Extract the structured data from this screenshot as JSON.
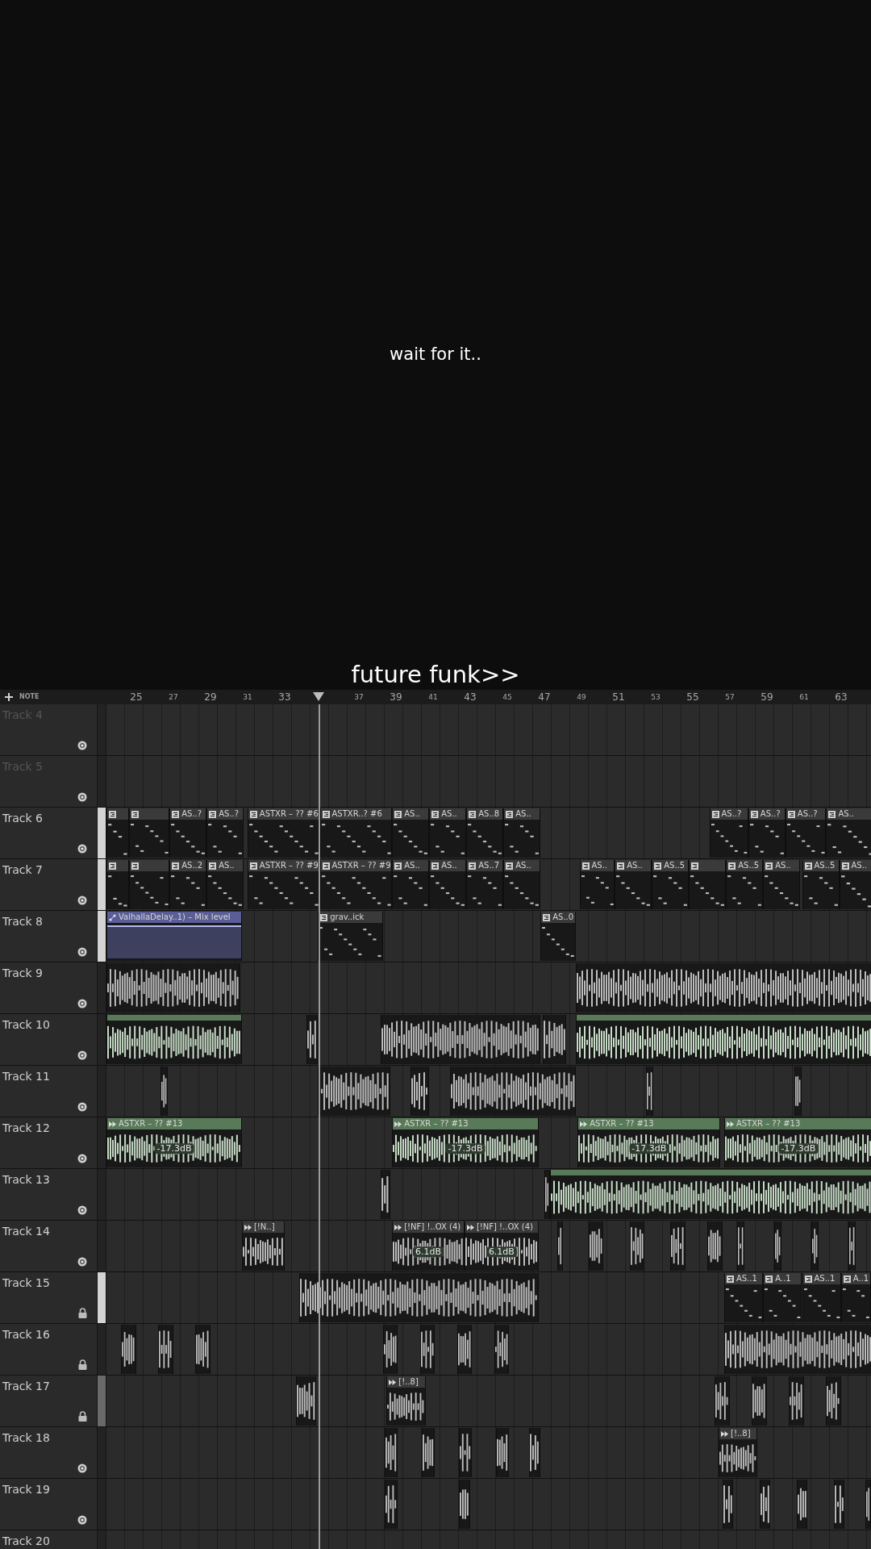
{
  "caption_top": "wait for it..",
  "caption_bottom": "future funk>>",
  "toolbar": {
    "mode": "NOTE"
  },
  "ruler": [
    "25",
    "27",
    "29",
    "31",
    "33",
    "37",
    "39",
    "41",
    "43",
    "45",
    "47",
    "49",
    "51",
    "53",
    "55",
    "57",
    "59",
    "61",
    "63"
  ],
  "tracks": [
    {
      "name": "Track 4",
      "muted": true,
      "locked": false
    },
    {
      "name": "Track 5",
      "muted": true,
      "locked": false
    },
    {
      "name": "Track 6",
      "muted": false,
      "locked": false,
      "color": "#d4d4d4",
      "clips": [
        {
          "kind": "pattern"
        },
        {
          "kind": "pattern"
        },
        {
          "kind": "pattern",
          "label": "AS..?"
        },
        {
          "kind": "pattern",
          "label": "AS..?"
        },
        {
          "kind": "pattern",
          "label": "ASTXR – ?? #6"
        },
        {
          "kind": "pattern",
          "label": "ASTXR..? #6"
        },
        {
          "kind": "pattern",
          "label": "AS.."
        },
        {
          "kind": "pattern",
          "label": "AS.."
        },
        {
          "kind": "pattern",
          "label": "AS..8"
        },
        {
          "kind": "pattern",
          "label": "AS.."
        },
        {
          "kind": "pattern",
          "label": "AS..?"
        },
        {
          "kind": "pattern",
          "label": "AS..?"
        },
        {
          "kind": "pattern",
          "label": "AS..?"
        },
        {
          "kind": "pattern",
          "label": "AS.."
        }
      ]
    },
    {
      "name": "Track 7",
      "muted": false,
      "locked": false,
      "color": "#d4d4d4",
      "clips": [
        {
          "kind": "pattern"
        },
        {
          "kind": "pattern"
        },
        {
          "kind": "pattern",
          "label": "AS..2"
        },
        {
          "kind": "pattern",
          "label": "AS.."
        },
        {
          "kind": "pattern",
          "label": "ASTXR – ?? #9"
        },
        {
          "kind": "pattern",
          "label": "ASTXR – ?? #9"
        },
        {
          "kind": "pattern",
          "label": "AS.."
        },
        {
          "kind": "pattern",
          "label": "AS.."
        },
        {
          "kind": "pattern",
          "label": "AS..7"
        },
        {
          "kind": "pattern",
          "label": "AS.."
        },
        {
          "kind": "pattern",
          "label": "AS.."
        },
        {
          "kind": "pattern",
          "label": "AS.."
        },
        {
          "kind": "pattern",
          "label": "AS..5"
        },
        {
          "kind": "pattern"
        },
        {
          "kind": "pattern",
          "label": "AS..5"
        },
        {
          "kind": "pattern",
          "label": "AS.."
        },
        {
          "kind": "pattern",
          "label": "AS..5"
        },
        {
          "kind": "pattern",
          "label": "AS.."
        }
      ]
    },
    {
      "name": "Track 8",
      "muted": false,
      "locked": false,
      "color": "#d4d4d4",
      "clips": [
        {
          "kind": "automation",
          "label": "ValhallaDelay..1) – Mix level"
        },
        {
          "kind": "pattern",
          "label": "grav..ick"
        },
        {
          "kind": "pattern",
          "label": "AS..0"
        }
      ]
    },
    {
      "name": "Track 9",
      "muted": false,
      "locked": false,
      "clips": [
        {
          "kind": "audio"
        },
        {
          "kind": "audio"
        }
      ]
    },
    {
      "name": "Track 10",
      "muted": false,
      "locked": false,
      "clips": [
        {
          "kind": "audio",
          "color": "#587a58"
        },
        {
          "kind": "audio"
        },
        {
          "kind": "audio"
        },
        {
          "kind": "audio"
        },
        {
          "kind": "audio",
          "color": "#587a58"
        }
      ]
    },
    {
      "name": "Track 11",
      "muted": false,
      "locked": false,
      "clips": [
        {
          "kind": "audio"
        },
        {
          "kind": "audio"
        },
        {
          "kind": "audio"
        },
        {
          "kind": "audio"
        },
        {
          "kind": "audio"
        },
        {
          "kind": "audio"
        }
      ]
    },
    {
      "name": "Track 12",
      "muted": false,
      "locked": false,
      "clips": [
        {
          "kind": "audio",
          "label": "ASTXR – ?? #13",
          "gain": "-17.3dB",
          "color": "#587a58"
        },
        {
          "kind": "audio",
          "label": "ASTXR – ?? #13",
          "gain": "-17.3dB",
          "color": "#587a58"
        },
        {
          "kind": "audio",
          "label": "ASTXR – ?? #13",
          "gain": "-17.3dB",
          "color": "#587a58"
        },
        {
          "kind": "audio",
          "label": "ASTXR – ?? #13",
          "gain": "-17.3dB",
          "color": "#587a58"
        }
      ]
    },
    {
      "name": "Track 13",
      "muted": false,
      "locked": false,
      "clips": [
        {
          "kind": "audio"
        },
        {
          "kind": "audio"
        },
        {
          "kind": "audio",
          "color": "#587a58"
        }
      ]
    },
    {
      "name": "Track 14",
      "muted": false,
      "locked": false,
      "clips": [
        {
          "kind": "audio",
          "label": "[!N..]"
        },
        {
          "kind": "audio",
          "label": "[!NF] !..OX (4)",
          "gain": "6.1dB"
        },
        {
          "kind": "audio",
          "label": "[!NF] !..OX (4)",
          "gain": "6.1dB"
        },
        {
          "kind": "audio"
        },
        {
          "kind": "audio"
        },
        {
          "kind": "audio"
        },
        {
          "kind": "audio"
        },
        {
          "kind": "audio"
        },
        {
          "kind": "audio"
        },
        {
          "kind": "audio"
        },
        {
          "kind": "audio"
        },
        {
          "kind": "audio"
        }
      ]
    },
    {
      "name": "Track 15",
      "muted": false,
      "locked": true,
      "color": "#d4d4d4",
      "clips": [
        {
          "kind": "audio"
        },
        {
          "kind": "pattern",
          "label": "AS..1"
        },
        {
          "kind": "pattern",
          "label": "A..1"
        },
        {
          "kind": "pattern",
          "label": "AS..1"
        },
        {
          "kind": "pattern",
          "label": "A..1"
        }
      ]
    },
    {
      "name": "Track 16",
      "muted": false,
      "locked": true,
      "clips": [
        {
          "kind": "audio"
        },
        {
          "kind": "audio"
        },
        {
          "kind": "audio"
        },
        {
          "kind": "audio"
        },
        {
          "kind": "audio"
        },
        {
          "kind": "audio"
        },
        {
          "kind": "audio"
        },
        {
          "kind": "audio"
        }
      ]
    },
    {
      "name": "Track 17",
      "muted": false,
      "locked": true,
      "color": "#6a6a6a",
      "clips": [
        {
          "kind": "audio"
        },
        {
          "kind": "audio",
          "label": "[!..8]"
        },
        {
          "kind": "audio"
        },
        {
          "kind": "audio"
        },
        {
          "kind": "audio"
        },
        {
          "kind": "audio"
        }
      ]
    },
    {
      "name": "Track 18",
      "muted": false,
      "locked": false,
      "clips": [
        {
          "kind": "audio"
        },
        {
          "kind": "audio"
        },
        {
          "kind": "audio"
        },
        {
          "kind": "audio"
        },
        {
          "kind": "audio"
        },
        {
          "kind": "audio",
          "label": "[!..8]"
        }
      ]
    },
    {
      "name": "Track 19",
      "muted": false,
      "locked": false,
      "clips": [
        {
          "kind": "audio"
        },
        {
          "kind": "audio"
        },
        {
          "kind": "audio"
        },
        {
          "kind": "audio"
        },
        {
          "kind": "audio"
        },
        {
          "kind": "audio"
        },
        {
          "kind": "audio"
        }
      ]
    },
    {
      "name": "Track 20",
      "muted": false
    }
  ]
}
